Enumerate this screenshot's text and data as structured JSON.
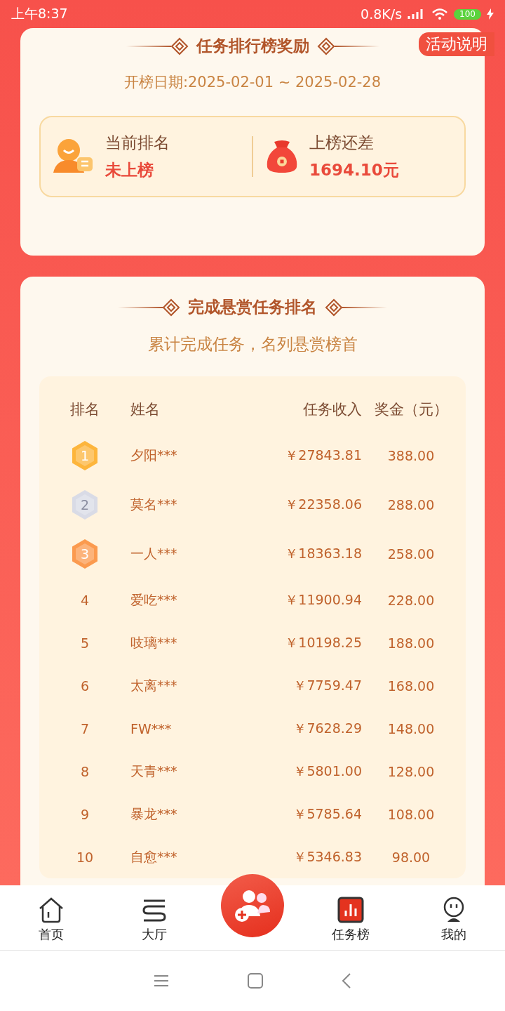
{
  "status_bar": {
    "time": "上午8:37",
    "speed": "0.8K/s",
    "battery": "100"
  },
  "reward_card": {
    "title": "任务排行榜奖励",
    "link": "活动说明",
    "period": "开榜日期:2025-02-01 ~ 2025-02-28",
    "stats": [
      {
        "kind": "rank",
        "label": "当前排名",
        "value": "未上榜"
      },
      {
        "kind": "gap",
        "label": "上榜还差",
        "value": "1694.10元"
      }
    ]
  },
  "ranking_card": {
    "title": "完成悬赏任务排名",
    "subtitle": "累计完成任务，名列悬赏榜首",
    "columns": [
      "排名",
      "姓名",
      "任务收入",
      "奖金（元）"
    ],
    "rows": [
      {
        "rank": "1",
        "kind": "medal",
        "color": "#fdb53c",
        "name": "夕阳***",
        "income": "￥27843.81",
        "bonus": "388.00"
      },
      {
        "rank": "2",
        "kind": "medal",
        "color": "#d9dbe6",
        "name": "莫名***",
        "income": "￥22358.06",
        "bonus": "288.00"
      },
      {
        "rank": "3",
        "kind": "medal",
        "color": "#fb9a4f",
        "name": "一人***",
        "income": "￥18363.18",
        "bonus": "258.00"
      },
      {
        "rank": "4",
        "kind": "plain",
        "name": "爱吃***",
        "income": "￥11900.94",
        "bonus": "228.00"
      },
      {
        "rank": "5",
        "kind": "plain",
        "name": "吱璃***",
        "income": "￥10198.25",
        "bonus": "188.00"
      },
      {
        "rank": "6",
        "kind": "plain",
        "name": "太离***",
        "income": "￥7759.47",
        "bonus": "168.00"
      },
      {
        "rank": "7",
        "kind": "plain",
        "name": "FW***",
        "income": "￥7628.29",
        "bonus": "148.00"
      },
      {
        "rank": "8",
        "kind": "plain",
        "name": "天青***",
        "income": "￥5801.00",
        "bonus": "128.00"
      },
      {
        "rank": "9",
        "kind": "plain",
        "name": "暴龙***",
        "income": "￥5785.64",
        "bonus": "108.00"
      },
      {
        "rank": "10",
        "kind": "plain",
        "name": "自愈***",
        "income": "￥5346.83",
        "bonus": "98.00"
      }
    ]
  },
  "tab_bar": [
    {
      "kind": "home",
      "label": "首页",
      "selected": false
    },
    {
      "kind": "hall",
      "label": "大厅",
      "selected": false
    },
    {
      "kind": "center"
    },
    {
      "kind": "board",
      "label": "任务榜",
      "selected": true
    },
    {
      "kind": "me",
      "label": "我的",
      "selected": false
    }
  ]
}
